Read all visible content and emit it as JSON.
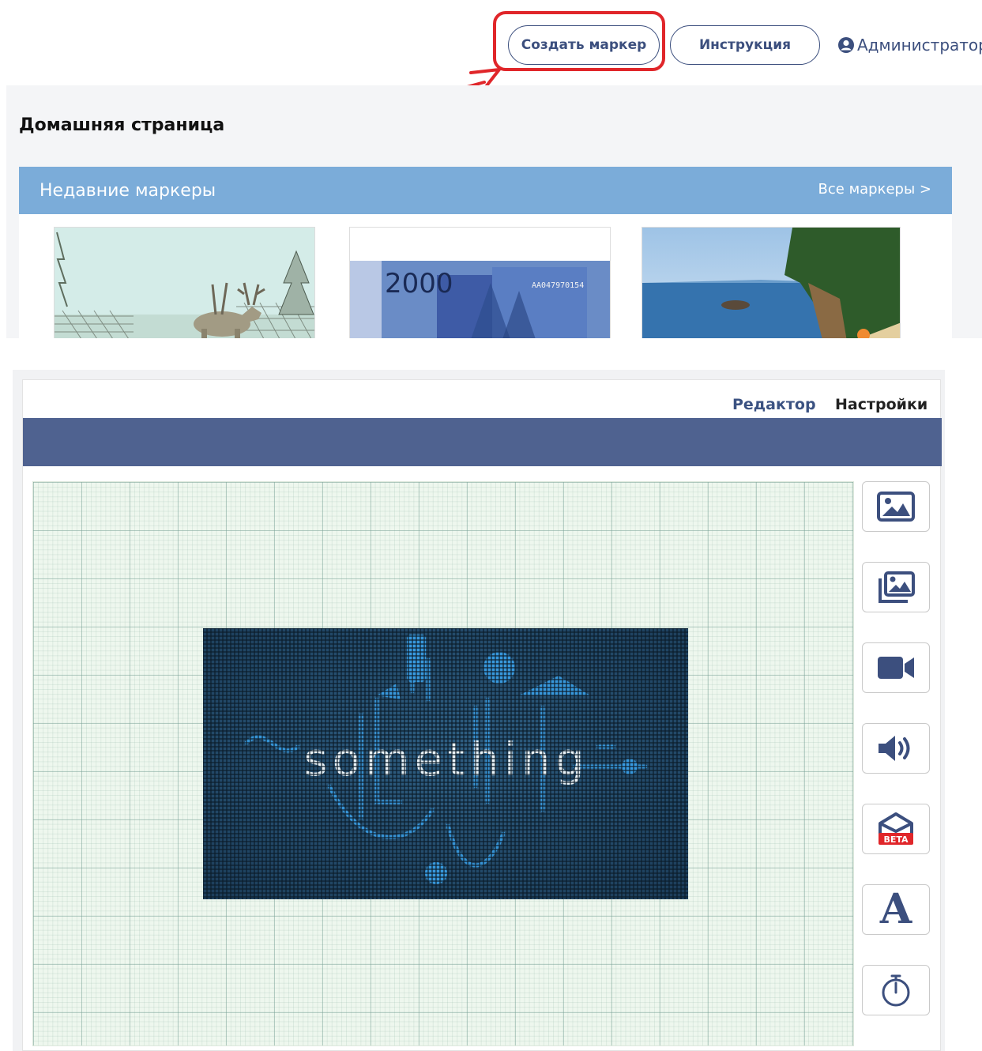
{
  "header": {
    "create_marker_label": "Создать маркер",
    "instructions_label": "Инструкция",
    "admin_label": "Администратор"
  },
  "home": {
    "title": "Домашняя страница",
    "recent": {
      "title": "Недавние маркеры",
      "all_link": "Все маркеры >",
      "thumbnails": [
        {
          "name": "moose"
        },
        {
          "name": "banknote",
          "text": "2000",
          "serial": "АА047970154"
        },
        {
          "name": "beach"
        }
      ]
    }
  },
  "editor": {
    "tabs": {
      "editor": "Редактор",
      "settings": "Настройки"
    },
    "marker_text": "something",
    "tools": [
      {
        "icon": "image-icon"
      },
      {
        "icon": "gallery-icon"
      },
      {
        "icon": "video-icon"
      },
      {
        "icon": "audio-icon"
      },
      {
        "icon": "3d-model-beta-icon",
        "badge": "BETA"
      },
      {
        "icon": "text-icon",
        "glyph": "A"
      },
      {
        "icon": "timer-icon"
      }
    ]
  },
  "colors": {
    "primary": "#3c4f7e",
    "highlight": "#e0262a",
    "recent_bar": "#7bacd9",
    "editor_bar": "#4f6290"
  }
}
